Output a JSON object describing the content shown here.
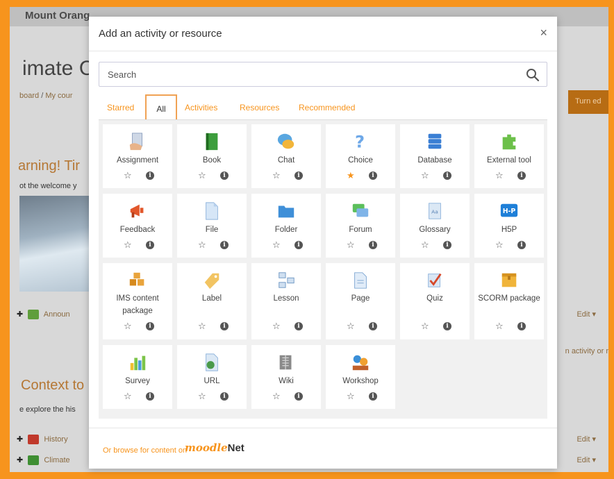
{
  "background": {
    "site_name": "Mount Orang",
    "course_title": "imate C",
    "breadcrumb": [
      "board",
      "My cour"
    ],
    "turn_edit": "Turn ed",
    "warning": "arning! Tir",
    "welcome": "ot the welcome y",
    "announce": "Announ",
    "activity_note": "n activity or r",
    "context": "Context to",
    "explore": "e explore the his",
    "history": "History",
    "climate": "Climate",
    "edit_label": "Edit ▾"
  },
  "modal": {
    "title": "Add an activity or resource",
    "close": "×",
    "search_placeholder": "Search"
  },
  "tabs": [
    {
      "label": "Starred",
      "active": false
    },
    {
      "label": "All",
      "active": true
    },
    {
      "label": "Activities",
      "active": false
    },
    {
      "label": "Resources",
      "active": false
    },
    {
      "label": "Recommended",
      "active": false
    }
  ],
  "items": [
    {
      "name": "Assignment",
      "icon": "assignment-icon",
      "starred": false
    },
    {
      "name": "Book",
      "icon": "book-icon",
      "starred": false
    },
    {
      "name": "Chat",
      "icon": "chat-icon",
      "starred": false
    },
    {
      "name": "Choice",
      "icon": "choice-icon",
      "starred": true
    },
    {
      "name": "Database",
      "icon": "database-icon",
      "starred": false
    },
    {
      "name": "External tool",
      "icon": "external-tool-icon",
      "starred": false
    },
    {
      "name": "Feedback",
      "icon": "feedback-icon",
      "starred": false
    },
    {
      "name": "File",
      "icon": "file-icon",
      "starred": false
    },
    {
      "name": "Folder",
      "icon": "folder-icon",
      "starred": false
    },
    {
      "name": "Forum",
      "icon": "forum-icon",
      "starred": false
    },
    {
      "name": "Glossary",
      "icon": "glossary-icon",
      "starred": false
    },
    {
      "name": "H5P",
      "icon": "h5p-icon",
      "starred": false
    },
    {
      "name": "IMS content package",
      "icon": "ims-package-icon",
      "starred": false
    },
    {
      "name": "Label",
      "icon": "label-icon",
      "starred": false
    },
    {
      "name": "Lesson",
      "icon": "lesson-icon",
      "starred": false
    },
    {
      "name": "Page",
      "icon": "page-icon",
      "starred": false
    },
    {
      "name": "Quiz",
      "icon": "quiz-icon",
      "starred": false
    },
    {
      "name": "SCORM package",
      "icon": "scorm-icon",
      "starred": false
    },
    {
      "name": "Survey",
      "icon": "survey-icon",
      "starred": false
    },
    {
      "name": "URL",
      "icon": "url-icon",
      "starred": false
    },
    {
      "name": "Wiki",
      "icon": "wiki-icon",
      "starred": false
    },
    {
      "name": "Workshop",
      "icon": "workshop-icon",
      "starred": false
    }
  ],
  "footer": {
    "text": "Or browse for content on",
    "brand_prefix": "moodle",
    "brand_suffix": "Net"
  },
  "colors": {
    "accent": "#f7941d",
    "frame": "#f7941d"
  }
}
